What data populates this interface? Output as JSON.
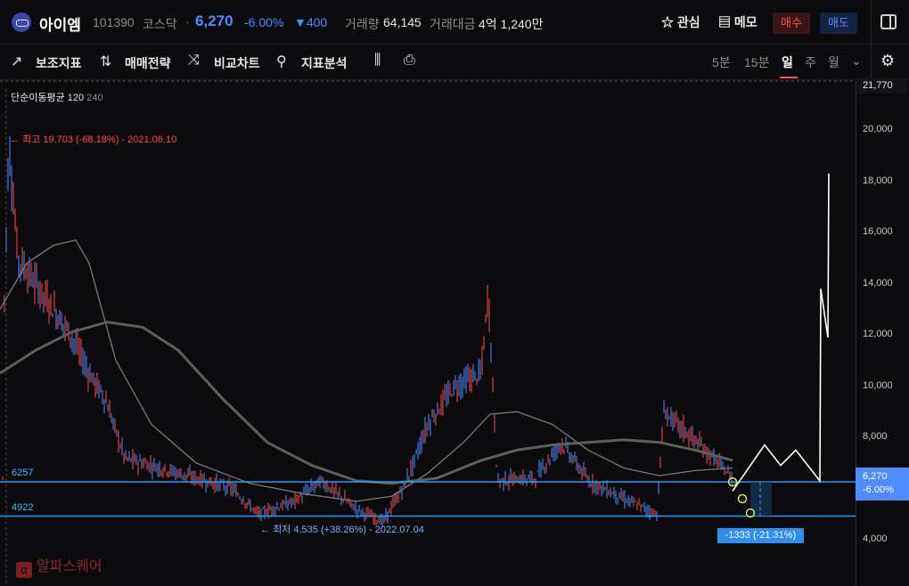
{
  "header": {
    "name": "아이엠",
    "code": "101390",
    "market": "코스닥",
    "separator": "·",
    "price": "6,270",
    "change_pct": "-6.00%",
    "change": "▼400",
    "volume_label": "거래량",
    "volume": "64,145",
    "amount_label": "거래대금",
    "amount": "4억 1,240만",
    "fav_label": "관심",
    "memo_label": "메모",
    "buy_label": "매수",
    "sell_label": "매도"
  },
  "toolbar": {
    "items": [
      "보조지표",
      "매매전략",
      "비교차트",
      "지표분석"
    ],
    "periods": [
      "5분",
      "15분",
      "일",
      "주",
      "월"
    ],
    "active_period": "일"
  },
  "chart_data": {
    "type": "line",
    "indicator": "단순이동평균",
    "ma_periods": [
      "120",
      "240"
    ],
    "yticks": [
      "20,000",
      "18,000",
      "16,000",
      "14,000",
      "12,000",
      "10,000",
      "8,000",
      "6,000",
      "4,000"
    ],
    "ylim": [
      3500,
      22000
    ],
    "current_price": 6270,
    "current_label": "6,270",
    "current_pct": "-6.00%",
    "top_label": "21,770",
    "high_annotation": "최고 19,703 (-68.18%) - 2021.06.10",
    "low_annotation": "최저 4,535 (+38.26%) - 2022.07.04",
    "levels": [
      {
        "label": "6257",
        "value": 6257
      },
      {
        "label": "4922",
        "value": 4922
      }
    ],
    "difference_label": "-1333 (-21.31%)",
    "trend_points": [
      5900,
      7700,
      6900,
      7500,
      6300,
      13800,
      11900,
      18300
    ],
    "colors": {
      "up": "#ff4d4d",
      "down": "#4f8cff",
      "level": "#2d9cf0",
      "ma120": "#7a7a7a",
      "ma240": "#5e5e5e",
      "trend": "#ffffff"
    }
  },
  "watermark": {
    "badge": "α",
    "text": "알파스퀘어"
  }
}
